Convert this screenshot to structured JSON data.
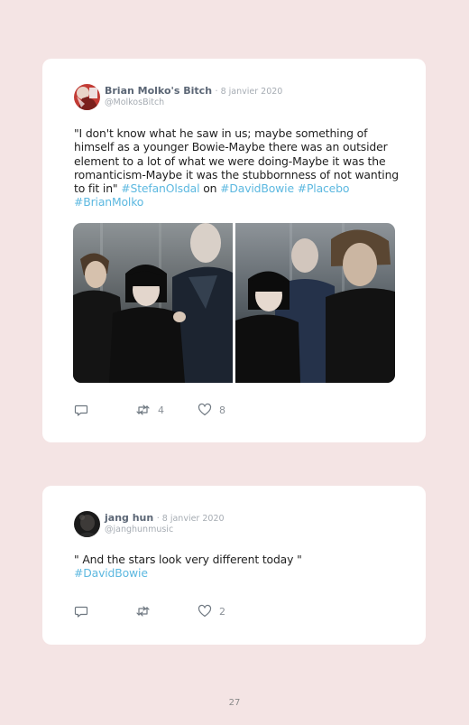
{
  "tweets": [
    {
      "author_name": "Brian Molko's Bitch",
      "date": "· 8 janvier 2020",
      "handle": "@MolkosBitch",
      "text_parts": [
        "\"I don't know what he saw in us; maybe something of himself as a younger Bowie-Maybe there was an outsider element to a lot of what we were doing-Maybe it was the romanticism-Maybe it was the stubbornness of not wanting to fit in\" ",
        "#StefanOlsdal",
        " on ",
        "#DavidBowie",
        " ",
        "#Placebo",
        " ",
        "#BrianMolko"
      ],
      "reply_count": "",
      "retweet_count": "4",
      "like_count": "8",
      "icons": [
        "reply-icon",
        "retweet-icon",
        "heart-icon"
      ]
    },
    {
      "author_name": "jang hun",
      "date": "· 8 janvier 2020",
      "handle": "@janghunmusic",
      "text_parts": [
        "\" And the stars look very different today \" ",
        "#DavidBowie"
      ],
      "reply_count": "",
      "retweet_count": "",
      "like_count": "2",
      "icons": [
        "reply-icon",
        "retweet-icon",
        "heart-icon"
      ]
    }
  ],
  "page_number": "27",
  "colors": {
    "page_bg": "#f4e4e4",
    "hashtag": "#5cb8e0",
    "name": "#5b6675",
    "meta": "#a6acb3"
  }
}
